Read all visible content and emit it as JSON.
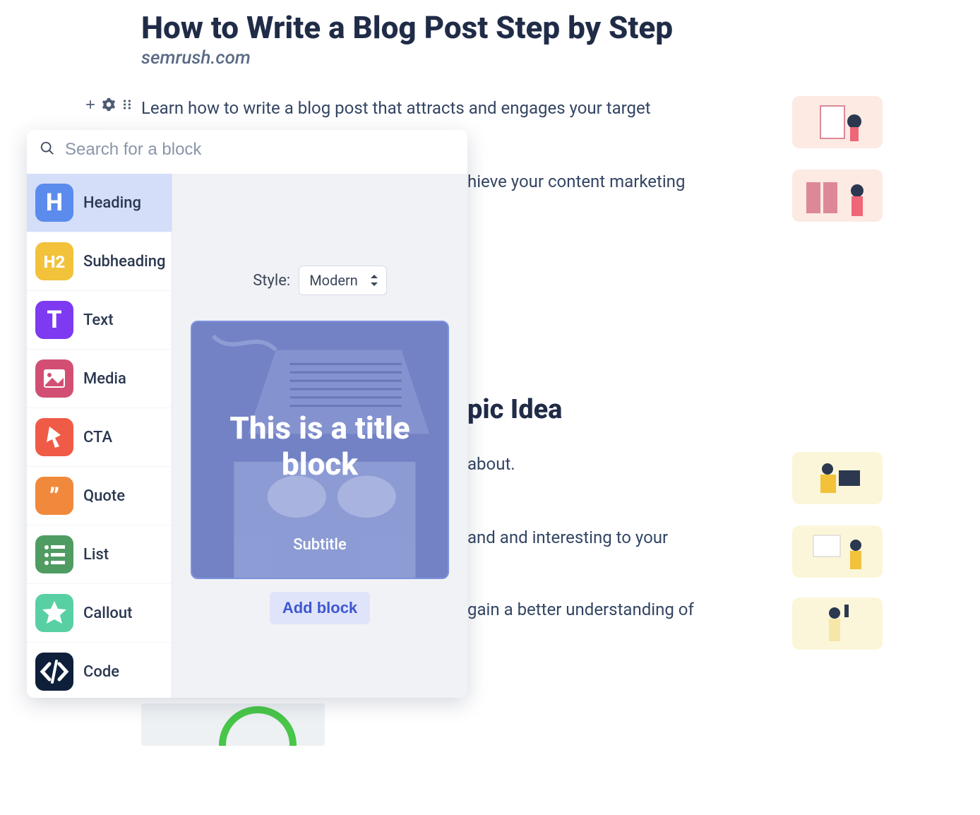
{
  "article": {
    "title": "How to Write a Blog Post Step by Step",
    "domain": "semrush.com",
    "lead1": "Learn how to write a blog post that attracts and engages your target",
    "lead2_fragment": "hieve your content marketing",
    "section_heading_fragment": "pic Idea",
    "line4_fragment": "about.",
    "line5_fragment": "and and interesting to your",
    "line6_fragment": "gain a better understanding of"
  },
  "popover": {
    "search_placeholder": "Search for a block",
    "style_label": "Style:",
    "style_value": "Modern",
    "preview_title": "This is a title block",
    "preview_subtitle": "Subtitle",
    "add_block": "Add block",
    "blocks": [
      {
        "id": "heading",
        "label": "Heading",
        "icon_text": "H",
        "color": "#5b8bec"
      },
      {
        "id": "subheading",
        "label": "Subheading",
        "icon_text": "H2",
        "color": "#f2c23a"
      },
      {
        "id": "text",
        "label": "Text",
        "icon_text": "T",
        "color": "#7d3af0"
      },
      {
        "id": "media",
        "label": "Media",
        "icon_text": "",
        "color": "#d24f73"
      },
      {
        "id": "cta",
        "label": "CTA",
        "icon_text": "",
        "color": "#ef5b46"
      },
      {
        "id": "quote",
        "label": "Quote",
        "icon_text": "",
        "color": "#f0893b"
      },
      {
        "id": "list",
        "label": "List",
        "icon_text": "",
        "color": "#4f9c62"
      },
      {
        "id": "callout",
        "label": "Callout",
        "icon_text": "",
        "color": "#58d0a3"
      },
      {
        "id": "code",
        "label": "Code",
        "icon_text": "",
        "color": "#0e1f3a"
      }
    ],
    "selected_block": "heading"
  }
}
